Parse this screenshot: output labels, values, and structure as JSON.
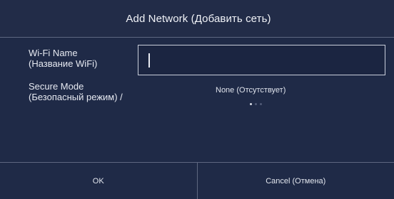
{
  "dialog": {
    "title": "Add Network (Добавить сеть)"
  },
  "wifi_name": {
    "label_line1": "Wi-Fi Name",
    "label_line2": "(Название WiFi)",
    "value": ""
  },
  "secure_mode": {
    "label_line1": "Secure Mode",
    "label_line2": "(Безопасный режим) /",
    "value": "None (Отсутствует)"
  },
  "footer": {
    "ok_label": "OK",
    "cancel_label": "Cancel (Отмена)"
  },
  "colors": {
    "background": "#1f2a47",
    "border": "#5e6781",
    "text": "#e9ecf3"
  }
}
